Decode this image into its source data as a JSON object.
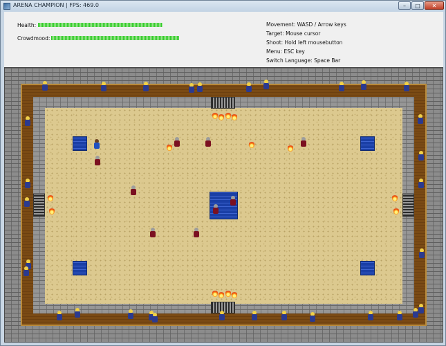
{
  "window": {
    "title": "ARENA CHAMPION | FPS: 469.0",
    "controls": {
      "minimize": "–",
      "maximize": "□",
      "close": "✕"
    }
  },
  "hud": {
    "health": {
      "label": "Health:",
      "level": 1.0
    },
    "crowdmood": {
      "label": "Crowdmood:",
      "level": 1.0
    },
    "help": [
      "Movement: WASD / Arrow keys",
      "Target: Mouse cursor",
      "Shoot: Hold left mousebutton",
      "Menu: ESC key",
      "Switch Language: Space Bar"
    ]
  },
  "colors": {
    "bar": "#35cc2c",
    "sand": "#dcc98f",
    "stands": "#7a4a14",
    "water": "#1a3fa6",
    "wall": "#8c8c8c"
  }
}
